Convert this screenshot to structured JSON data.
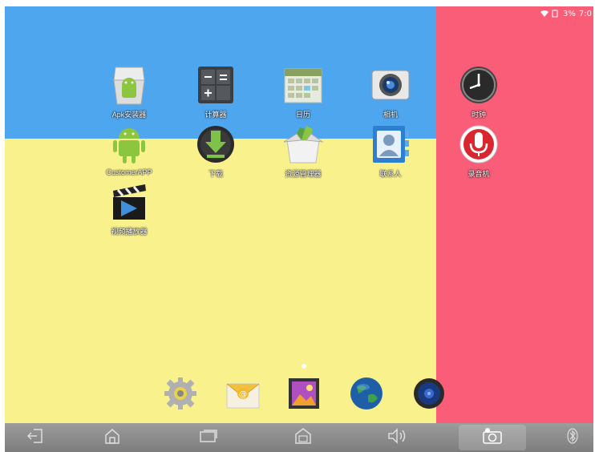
{
  "status": {
    "battery_text": "3%",
    "time": "7:0"
  },
  "apps": [
    {
      "id": "apk-installer",
      "label": "Apk安装器",
      "icon": "android-installer-icon"
    },
    {
      "id": "calculator",
      "label": "计算器",
      "icon": "calculator-icon"
    },
    {
      "id": "calendar",
      "label": "日历",
      "icon": "calendar-icon"
    },
    {
      "id": "camera",
      "label": "相机",
      "icon": "camera-icon"
    },
    {
      "id": "clock",
      "label": "时钟",
      "icon": "clock-icon"
    },
    {
      "id": "custom-app",
      "label": "CustomerAPP",
      "icon": "android-icon"
    },
    {
      "id": "downloads",
      "label": "下载",
      "icon": "download-icon"
    },
    {
      "id": "file-manager",
      "label": "资源管理器",
      "icon": "file-manager-icon"
    },
    {
      "id": "contacts",
      "label": "联系人",
      "icon": "contacts-icon"
    },
    {
      "id": "recorder",
      "label": "录音机",
      "icon": "microphone-icon"
    },
    {
      "id": "video-player",
      "label": "视频播放器",
      "icon": "video-player-icon"
    }
  ],
  "dock": [
    {
      "id": "settings",
      "icon": "settings-gear-icon"
    },
    {
      "id": "email",
      "icon": "email-icon"
    },
    {
      "id": "gallery",
      "icon": "gallery-icon"
    },
    {
      "id": "browser",
      "icon": "globe-icon"
    },
    {
      "id": "music",
      "icon": "speaker-icon"
    }
  ],
  "navbar": [
    {
      "id": "back",
      "icon": "back-icon"
    },
    {
      "id": "home",
      "icon": "home-icon"
    },
    {
      "id": "recents",
      "icon": "recent-apps-icon"
    },
    {
      "id": "screenshot",
      "icon": "screenshot-icon"
    },
    {
      "id": "volume",
      "icon": "volume-icon"
    },
    {
      "id": "camera",
      "icon": "camera-switch-icon"
    },
    {
      "id": "bluetooth",
      "icon": "bluetooth-icon"
    }
  ],
  "colors": {
    "top_blue": "#4ea6ee",
    "bottom_yellow": "#f9f28c",
    "right_pink": "#f95d77",
    "navbar": "#8a8a8a"
  }
}
